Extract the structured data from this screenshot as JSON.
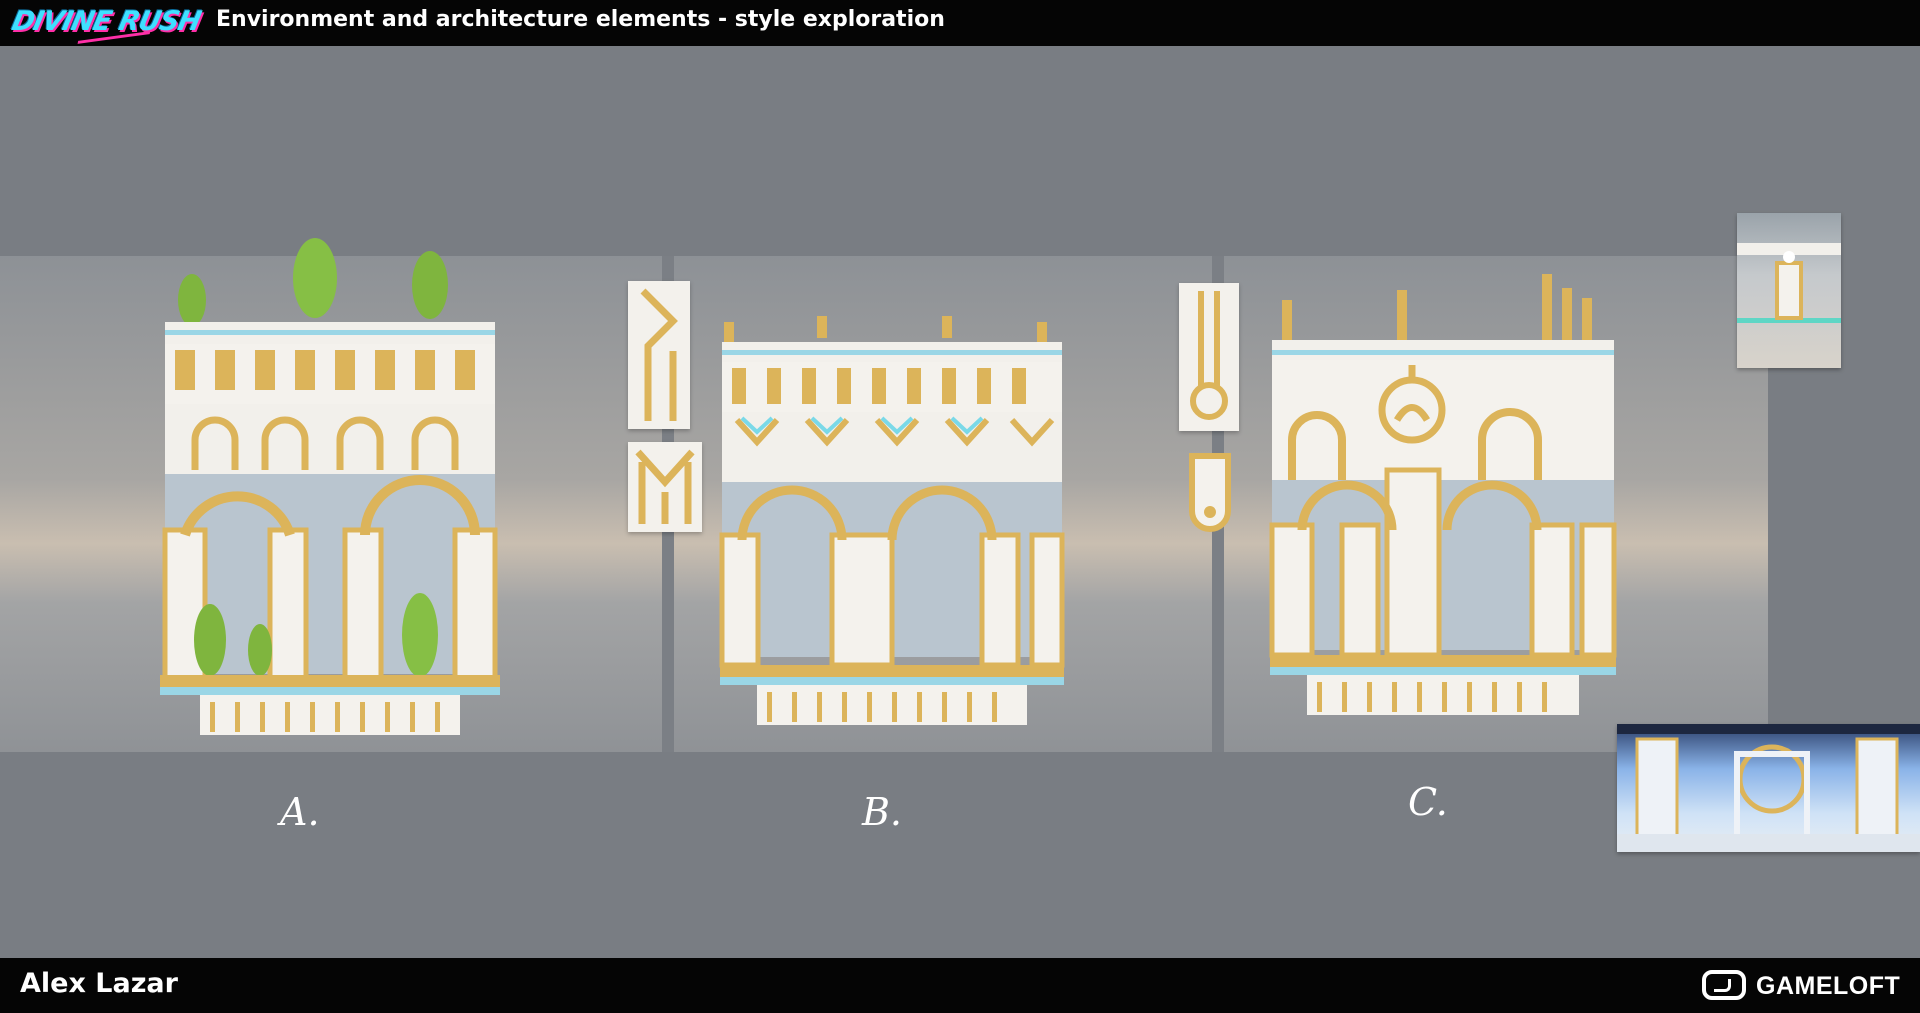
{
  "header": {
    "logo_text": "DIVINE RUSH",
    "title": "Environment and architecture elements - style exploration"
  },
  "footer": {
    "author": "Alex Lazar",
    "brand": "GAMELOFT"
  },
  "concepts": [
    {
      "label": "A."
    },
    {
      "label": "B."
    },
    {
      "label": "C."
    }
  ],
  "colors": {
    "background": "#797d83",
    "bar": "#050505",
    "gold": "#dcb45a",
    "marble": "#f2f0eb",
    "accent_cyan": "#7ad9e8",
    "foliage": "#7fb53e"
  }
}
